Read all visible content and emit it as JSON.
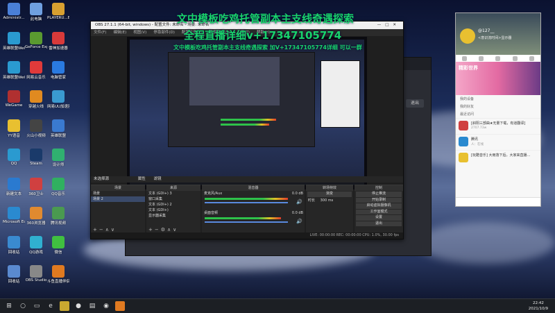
{
  "overlay": {
    "line1": "文中模板吃鸡托管副本主支线奇遇探索",
    "line2": "全程直播详细v+17347105774",
    "line3": "文中模板吃鸡托管副本主支线奇遇探索 加V+17347105774详细 可以一群"
  },
  "desktop_icons": [
    {
      "label": "Administr..."
    },
    {
      "label": "此电脑"
    },
    {
      "label": "PLAYERU...BATTLEGR..."
    },
    {
      "label": "英雄联盟WeGame版"
    },
    {
      "label": "GeForce Experience"
    },
    {
      "label": "雷神加速器"
    },
    {
      "label": "英雄联盟WeGame版"
    },
    {
      "label": "网易云音乐"
    },
    {
      "label": "电脑管家"
    },
    {
      "label": "WeGame"
    },
    {
      "label": "穿越火线"
    },
    {
      "label": "网易UU加速器"
    },
    {
      "label": "YY语音"
    },
    {
      "label": "火山小视频"
    },
    {
      "label": "英雄联盟"
    },
    {
      "label": "QQ"
    },
    {
      "label": "Steam"
    },
    {
      "label": "设计师"
    },
    {
      "label": "新建文本"
    },
    {
      "label": "360卫士"
    },
    {
      "label": "QQ音乐"
    },
    {
      "label": "Microsoft Edge"
    },
    {
      "label": "360浏览器"
    },
    {
      "label": "腾讯视频"
    },
    {
      "label": "回收站"
    },
    {
      "label": "QQ游戏"
    },
    {
      "label": "微信"
    },
    {
      "label": "回收站"
    },
    {
      "label": "OBS Studio"
    },
    {
      "label": "斗鱼直播伴侣"
    }
  ],
  "obs": {
    "title": "OBS 27.1.1 (64-bit, windows) - 配置文件: 未命名 - 场景: 未命名",
    "menu": [
      "文件(F)",
      "编辑(E)",
      "视图(V)",
      "停靠部件(D)",
      "配置文件(P)",
      "场景集合(S)",
      "工具(T)",
      "帮助(H)"
    ],
    "scene_bar_label": "未选择源",
    "scene_bar_props": "属性",
    "scene_bar_filters": "滤镜",
    "panels": {
      "scenes_header": "场景",
      "scenes": [
        "场景",
        "场景 2"
      ],
      "sources_header": "来源",
      "sources": [
        "文本 (GDI+) 3",
        "窗口采集",
        "文本 (GDI+) 2",
        "文本 (GDI+)",
        "显示器采集"
      ],
      "mixer_header": "混音器",
      "mixer_tracks": [
        {
          "name": "麦克风/Aux",
          "db": "0.0 dB"
        },
        {
          "name": "桌面音频",
          "db": "0.0 dB"
        }
      ],
      "transitions_header": "转场特效",
      "transition_type": "渐变",
      "duration_label": "时长",
      "duration_value": "300 ms",
      "controls_header": "控制",
      "controls": [
        "停止推流",
        "开始录制",
        "启动虚拟摄像机",
        "工作室模式",
        "设置",
        "退出"
      ]
    },
    "status": "LIVE: 00:00:00   REC: 00:00:00   CPU: 1.0%, 30.00 fps",
    "back_window_button": "退出"
  },
  "qq": {
    "nickname": "@127__",
    "signature": "<意识流时间>显示器",
    "banner_text": "精彩世界",
    "section_items": [
      "我的设备",
      "我的好友",
      "最近访问"
    ],
    "messages": [
      {
        "title": "[斜阳三部曲★无量下载，有道翻译]",
        "sub": "2707.73w"
      },
      {
        "title": "腾讯",
        "sub": "人：在线"
      },
      {
        "title": "[玩酷音乐] 大雨落下后，大家来直播…",
        "sub": ""
      }
    ]
  },
  "taskbar": {
    "time": "22:42",
    "date": "2021/10/9"
  },
  "colors": {
    "overlay_green": "#19d36a",
    "obs_bg": "#1f1f1f",
    "meter_green": "#2ec24a"
  }
}
